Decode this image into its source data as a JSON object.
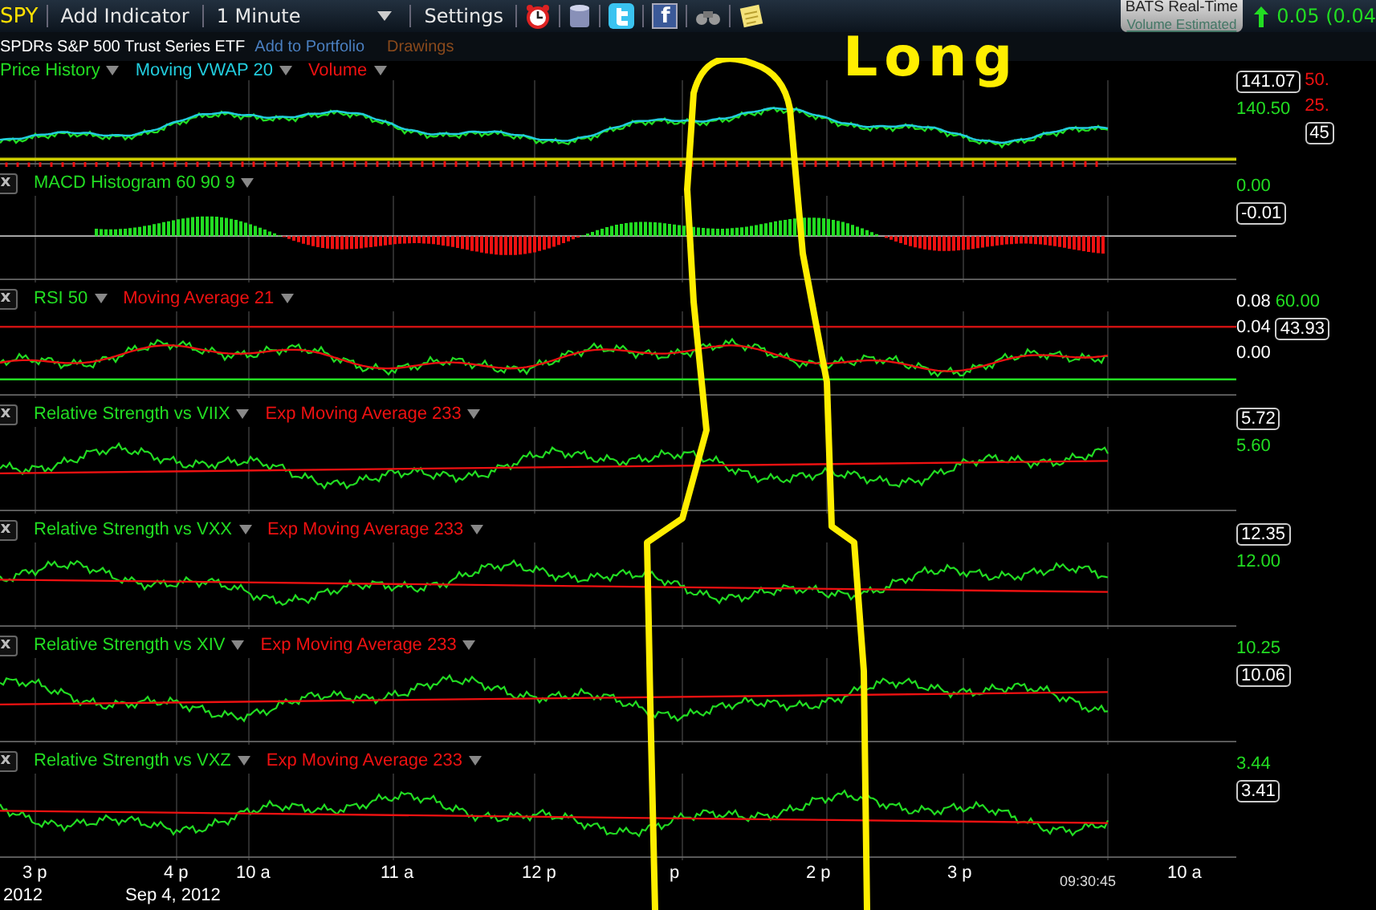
{
  "toolbar": {
    "symbol": "SPY",
    "add_indicator": "Add Indicator",
    "interval": "1 Minute",
    "settings": "Settings",
    "facebook_letter": "f",
    "feed_badge": {
      "title": "BATS Real-Time",
      "subtitle": "Volume Estimated"
    },
    "change": "0.05 (0.04"
  },
  "subheader": {
    "name": "SPDRs S&P 500 Trust Series ETF",
    "add_to_portfolio": "Add to Portfolio",
    "drawings": "Drawings"
  },
  "panels": [
    {
      "kind": "price",
      "legend": [
        {
          "label": "Price History",
          "color": "#22dd22"
        },
        {
          "label": "Moving VWAP 20",
          "color": "#22ccdd"
        },
        {
          "label": "Volume",
          "color": "#ee1111"
        }
      ],
      "axis": [
        {
          "text": "141.07",
          "kind": "current"
        },
        {
          "text": "140.50",
          "kind": "level",
          "color": "#22dd22"
        }
      ],
      "axis_2": [
        {
          "text": "50.",
          "kind": "level",
          "color": "#ee1111"
        },
        {
          "text": "25.",
          "kind": "level",
          "color": "#ee1111"
        },
        {
          "text": "45",
          "kind": "current"
        }
      ]
    },
    {
      "kind": "histogram",
      "close": "x",
      "legend": [
        {
          "label": "MACD Histogram 60 90 9",
          "color": "#22dd22"
        }
      ],
      "axis": [
        {
          "text": "0.00",
          "kind": "level",
          "color": "#22dd22"
        },
        {
          "text": "-0.01",
          "kind": "current"
        }
      ]
    },
    {
      "kind": "oscillator",
      "close": "x",
      "legend": [
        {
          "label": "RSI 50",
          "color": "#22dd22"
        },
        {
          "label": "Moving Average 21",
          "color": "#ee1111"
        }
      ],
      "axis": [
        {
          "text": "0.08",
          "kind": "level",
          "color": "#ffffff"
        },
        {
          "text": "0.04",
          "kind": "level",
          "color": "#ffffff"
        },
        {
          "text": "0.00",
          "kind": "level",
          "color": "#ffffff"
        }
      ],
      "axis_2": [
        {
          "text": "60.00",
          "kind": "level",
          "color": "#22dd22"
        },
        {
          "text": "43.93",
          "kind": "current"
        }
      ]
    },
    {
      "kind": "ratio",
      "close": "x",
      "legend": [
        {
          "label": "Relative Strength vs VIIX",
          "color": "#22dd22"
        },
        {
          "label": "Exp Moving Average 233",
          "color": "#ee1111"
        }
      ],
      "axis": [
        {
          "text": "5.72",
          "kind": "current"
        },
        {
          "text": "5.60",
          "kind": "level",
          "color": "#22dd22"
        }
      ]
    },
    {
      "kind": "ratio",
      "close": "x",
      "legend": [
        {
          "label": "Relative Strength vs VXX",
          "color": "#22dd22"
        },
        {
          "label": "Exp Moving Average 233",
          "color": "#ee1111"
        }
      ],
      "axis": [
        {
          "text": "12.35",
          "kind": "current"
        },
        {
          "text": "12.00",
          "kind": "level",
          "color": "#22dd22"
        }
      ]
    },
    {
      "kind": "ratio",
      "close": "x",
      "legend": [
        {
          "label": "Relative Strength vs XIV",
          "color": "#22dd22"
        },
        {
          "label": "Exp Moving Average 233",
          "color": "#ee1111"
        }
      ],
      "axis": [
        {
          "text": "10.25",
          "kind": "level",
          "color": "#22dd22"
        },
        {
          "text": "10.06",
          "kind": "current"
        }
      ]
    },
    {
      "kind": "ratio",
      "close": "x",
      "legend": [
        {
          "label": "Relative Strength vs VXZ",
          "color": "#22dd22"
        },
        {
          "label": "Exp Moving Average 233",
          "color": "#ee1111"
        }
      ],
      "axis": [
        {
          "text": "3.44",
          "kind": "level",
          "color": "#22dd22"
        },
        {
          "text": "3.41",
          "kind": "current"
        }
      ]
    }
  ],
  "time_axis": {
    "ticks": [
      "3 p",
      "4 p",
      "10 a",
      "11 a",
      "12 p",
      "p",
      "2 p",
      "3 p",
      "10 a"
    ],
    "clock": "09:30:45",
    "dates": [
      "2012",
      "Sep 4, 2012"
    ]
  },
  "annotation": {
    "text": "Long"
  }
}
